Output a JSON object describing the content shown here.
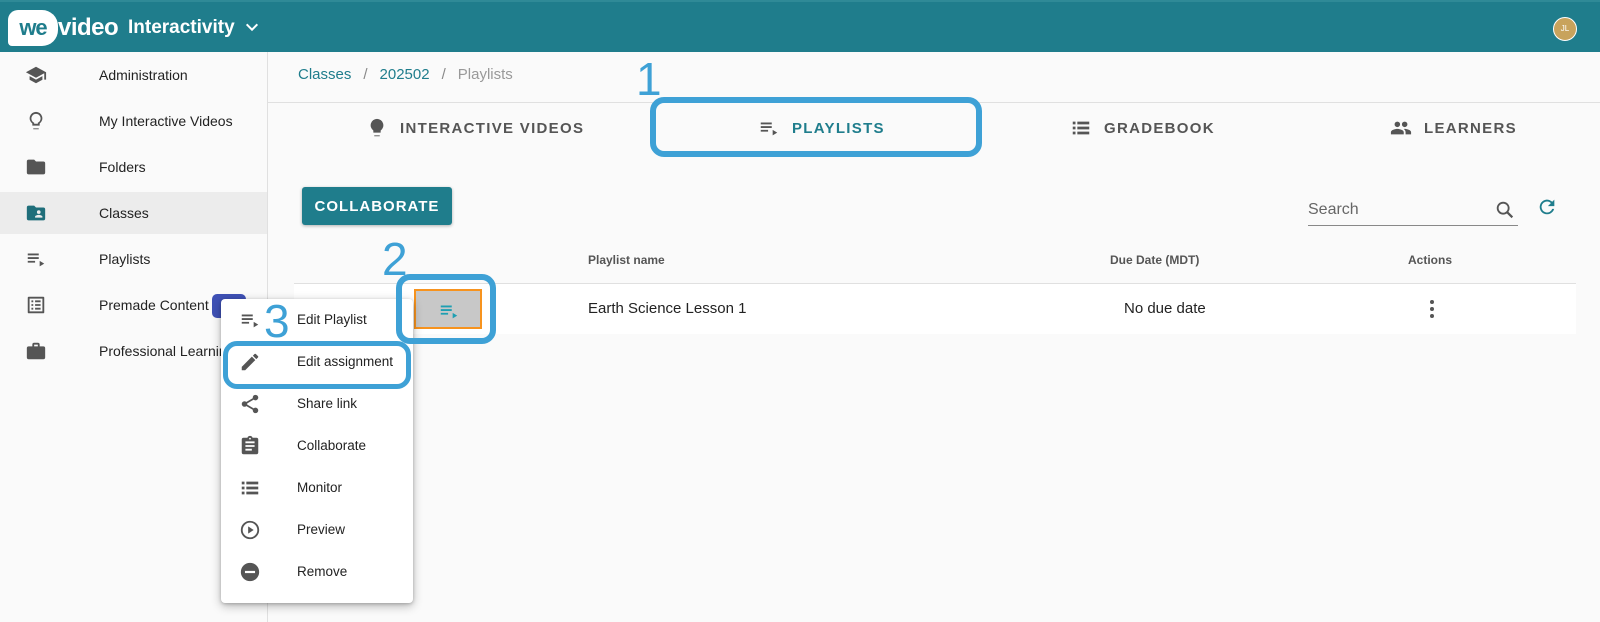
{
  "header": {
    "logo_we": "we",
    "logo_video": "video",
    "app_title": "Interactivity",
    "avatar_initials": "JL"
  },
  "sidebar": {
    "items": [
      {
        "label": "Administration",
        "icon": "school-icon",
        "active": false
      },
      {
        "label": "My Interactive Videos",
        "icon": "lightbulb-icon",
        "active": false
      },
      {
        "label": "Folders",
        "icon": "folder-icon",
        "active": false
      },
      {
        "label": "Classes",
        "icon": "shared-folder-icon",
        "active": true
      },
      {
        "label": "Playlists",
        "icon": "playlist-icon",
        "active": false
      },
      {
        "label": "Premade Content",
        "icon": "list-alt-icon",
        "active": false
      },
      {
        "label": "Professional Learnin",
        "icon": "briefcase-icon",
        "active": false
      }
    ]
  },
  "breadcrumb": {
    "items": [
      "Classes",
      "202502",
      "Playlists"
    ],
    "separator": "/"
  },
  "tabs": [
    {
      "label": "INTERACTIVE VIDEOS",
      "icon": "lightbulb-icon",
      "active": false
    },
    {
      "label": "PLAYLISTS",
      "icon": "playlist-icon",
      "active": true
    },
    {
      "label": "GRADEBOOK",
      "icon": "list-icon",
      "active": false
    },
    {
      "label": "LEARNERS",
      "icon": "people-icon",
      "active": false
    }
  ],
  "toolbar": {
    "collaborate_label": "COLLABORATE",
    "search_placeholder": "Search"
  },
  "table": {
    "headers": {
      "name": "Playlist name",
      "due": "Due Date (MDT)",
      "actions": "Actions"
    },
    "rows": [
      {
        "name": "Earth Science Lesson 1",
        "due": "No due date"
      }
    ]
  },
  "context_menu": {
    "items": [
      {
        "label": "Edit Playlist",
        "icon": "playlist-icon"
      },
      {
        "label": "Edit assignment",
        "icon": "pencil-icon"
      },
      {
        "label": "Share link",
        "icon": "share-icon"
      },
      {
        "label": "Collaborate",
        "icon": "clipboard-icon"
      },
      {
        "label": "Monitor",
        "icon": "list-icon"
      },
      {
        "label": "Preview",
        "icon": "play-circle-icon"
      },
      {
        "label": "Remove",
        "icon": "remove-circle-icon"
      }
    ]
  },
  "callouts": [
    "1",
    "2",
    "3"
  ],
  "colors": {
    "brand": "#1f7d8c",
    "callout": "#3ea1d6",
    "badge": "#3f51b5",
    "thumb_border": "#f7931e"
  }
}
